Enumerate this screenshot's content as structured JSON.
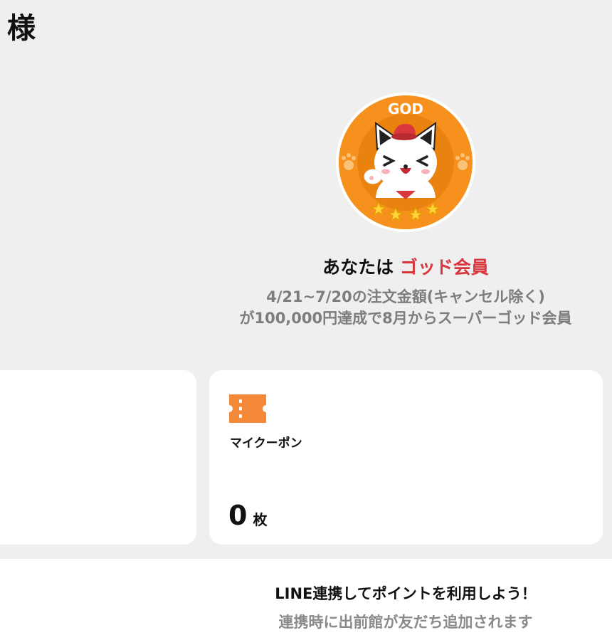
{
  "header": {
    "honorific": "様"
  },
  "membership": {
    "badge_label": "GOD",
    "badge_icon": "god-cat-badge-icon",
    "prefix": "あなたは",
    "rank": "ゴッド会員",
    "rank_color": "#d9363e",
    "condition_line1": "4/21~7/20の注文金額(キャンセル除く)",
    "condition_line2": "が100,000円達成で8月からスーパーゴッド会員",
    "stars": 4
  },
  "coupon_card": {
    "icon": "ticket-icon",
    "icon_color": "#f5893a",
    "title": "マイクーポン",
    "count": "0",
    "unit": "枚"
  },
  "line_link": {
    "title": "LINE連携してポイントを利用しよう！",
    "subtitle": "連携時に出前館が友だち追加されます"
  }
}
